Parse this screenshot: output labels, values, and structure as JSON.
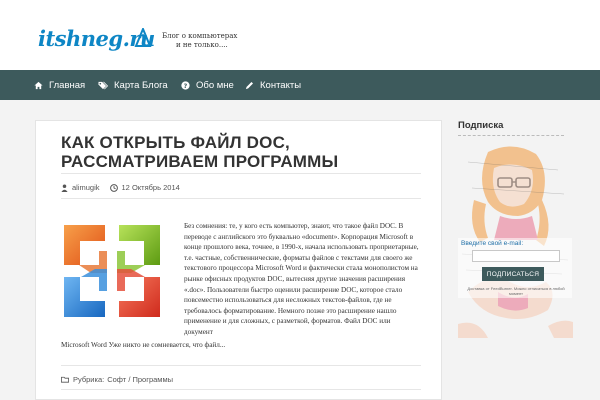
{
  "header": {
    "logo_text": "itshneg.ru",
    "tagline_line1": "Блог о компьютерах",
    "tagline_line2": "и не только...."
  },
  "nav": {
    "items": [
      {
        "label": "Главная",
        "icon": "home-icon"
      },
      {
        "label": "Карта Блога",
        "icon": "tags-icon"
      },
      {
        "label": "Обо мне",
        "icon": "question-icon"
      },
      {
        "label": "Контакты",
        "icon": "pencil-icon"
      }
    ]
  },
  "post": {
    "title": "КАК ОТКРЫТЬ ФАЙЛ DOC, РАССМАТРИВАЕМ ПРОГРАММЫ",
    "author": "alimugik",
    "date": "12 Октябрь 2014",
    "excerpt": "Без сомнения: те, у кого есть компьютер, знают, что такое файл DOC. В переводе с английского это буквально «document». Корпорация  Microsoft в конце прошлого века, точнее, в 1990-х, начала использовать проприетарные, т.е. частные, собственнические, форматы файлов с текстами для своего же текстового процессора Microsoft Word и фактически стала монополистом на рынке офисных продуктов DOC, вытесняя другие значения расширения «.doc». Пользователи быстро оценили расширение DOC, которое стало повсеместно использоваться для несложных текстов-файлов, где не требовалось форматирование. Немного позже это расширение нашло применение и для сложных, с разметкой, форматов. Файл DOC или документ",
    "excerpt_tail": "Microsoft Word Уже никто не сомневается, что файл...",
    "category_label": "Рубрика:",
    "category_value": "Софт / Программы"
  },
  "sidebar": {
    "title": "Подписка",
    "email_label": "Введите свой e-mail:",
    "email_placeholder": "",
    "subscribe_button": "ПОДПИСАТЬСЯ",
    "note": "Доставка от FeedBurner. Можно отписаться в любой момент"
  },
  "colors": {
    "nav_bg": "#3d5a5c",
    "logo": "#0e86c5",
    "office_orange": "#e8601c",
    "office_green": "#7cb518",
    "office_blue": "#1f7fd0",
    "office_red": "#e5372a"
  }
}
